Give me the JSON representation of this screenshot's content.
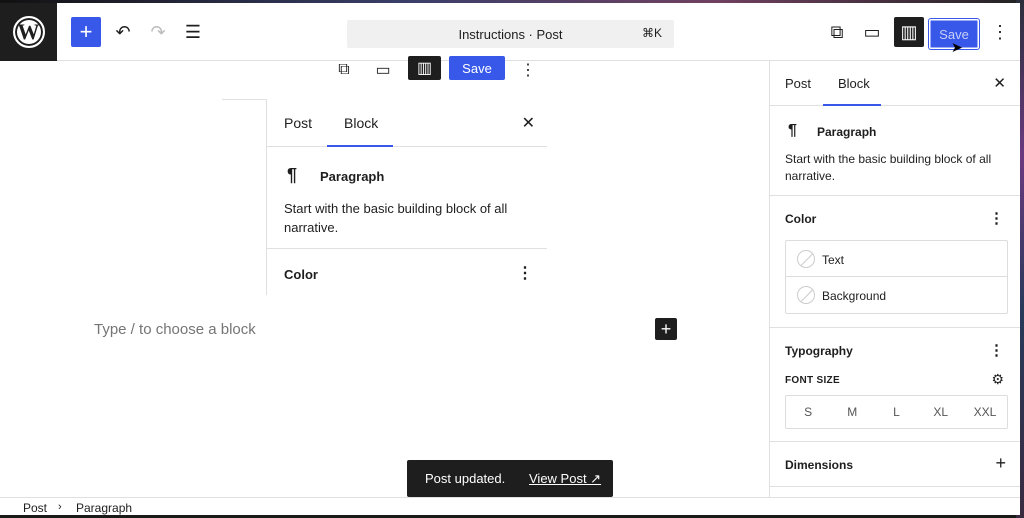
{
  "header": {
    "command_bar_title": "Instructions · Post",
    "command_bar_shortcut": "⌘K",
    "save_label": "Save",
    "icons": {
      "add": "+",
      "undo": "↶",
      "redo": "↷",
      "outline": "☰",
      "view_post": "⧉",
      "preview": "▭",
      "settings": "▥",
      "more": "⋮"
    }
  },
  "ghost_toolbar": {
    "save_label": "Save"
  },
  "ghost_panel": {
    "tab_post": "Post",
    "tab_block": "Block",
    "block_title": "Paragraph",
    "block_description": "Start with the basic building block of all narrative.",
    "color_title": "Color"
  },
  "canvas": {
    "placeholder": "Type / to choose a block"
  },
  "snackbar": {
    "message": "Post updated.",
    "link": "View Post ↗"
  },
  "sidebar": {
    "tab_post": "Post",
    "tab_block": "Block",
    "block_title": "Paragraph",
    "block_description": "Start with the basic building block of all narrative.",
    "color": {
      "title": "Color",
      "items": [
        {
          "label": "Text"
        },
        {
          "label": "Background"
        }
      ]
    },
    "typography": {
      "title": "Typography",
      "font_size_label": "FONT SIZE",
      "sizes": [
        "S",
        "M",
        "L",
        "XL",
        "XXL"
      ]
    },
    "dimensions": {
      "title": "Dimensions"
    }
  },
  "breadcrumb": {
    "items": [
      "Post",
      "Paragraph"
    ]
  },
  "colors": {
    "accent": "#3858e9",
    "dark": "#1e1e1e"
  }
}
